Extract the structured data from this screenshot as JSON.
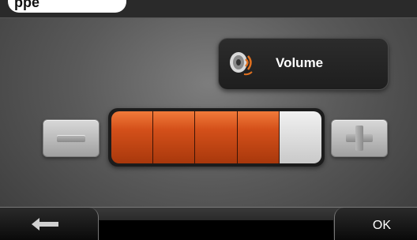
{
  "header": {
    "title_fragment": "ppe"
  },
  "volume_panel": {
    "label": "Volume",
    "icon": "speaker-icon"
  },
  "volume": {
    "level": 4,
    "max": 5
  },
  "controls": {
    "minus_icon": "minus-icon",
    "plus_icon": "plus-icon"
  },
  "footer": {
    "back_icon": "back-arrow-icon",
    "ok_label": "OK"
  },
  "colors": {
    "accent": "#d4501a",
    "empty_segment": "#dcdcdc"
  }
}
